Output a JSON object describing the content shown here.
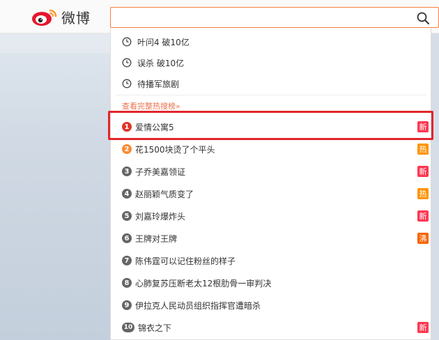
{
  "header": {
    "logo_text": "微博",
    "search": {
      "value": "",
      "placeholder": ""
    }
  },
  "dropdown": {
    "history": [
      {
        "label": "叶问4 破10亿"
      },
      {
        "label": "误杀 破10亿"
      },
      {
        "label": "待播军旅剧"
      }
    ],
    "full_list_link": "查看完整热搜榜»",
    "hot_items": [
      {
        "rank": "1",
        "label": "爱情公寓5",
        "badge": "新",
        "badge_type": "new"
      },
      {
        "rank": "2",
        "label": "花1500块烫了个平头",
        "badge": "热",
        "badge_type": "hot"
      },
      {
        "rank": "3",
        "label": "子乔美嘉领证",
        "badge": "新",
        "badge_type": "new"
      },
      {
        "rank": "4",
        "label": "赵丽颖气质变了",
        "badge": "热",
        "badge_type": "hot"
      },
      {
        "rank": "5",
        "label": "刘嘉玲爆炸头",
        "badge": "新",
        "badge_type": "new"
      },
      {
        "rank": "6",
        "label": "王牌对王牌",
        "badge": "沸",
        "badge_type": "boil"
      },
      {
        "rank": "7",
        "label": "陈伟霆可以记住粉丝的样子",
        "badge": "",
        "badge_type": ""
      },
      {
        "rank": "8",
        "label": "心肺复苏压断老太12根肋骨一审判决",
        "badge": "",
        "badge_type": ""
      },
      {
        "rank": "9",
        "label": "伊拉克人民动员组织指挥官遭暗杀",
        "badge": "",
        "badge_type": ""
      },
      {
        "rank": "10",
        "label": "锦衣之下",
        "badge": "新",
        "badge_type": "new"
      }
    ]
  },
  "colors": {
    "accent": "#fa7d3c",
    "link": "#eb7350",
    "highlight_border": "#e1262c",
    "badge_new": "#ff3852",
    "badge_hot": "#ff9406",
    "badge_boil": "#f86400"
  },
  "icons": {
    "logo": "weibo-logo-icon",
    "search": "search-icon",
    "history": "clock-icon"
  }
}
